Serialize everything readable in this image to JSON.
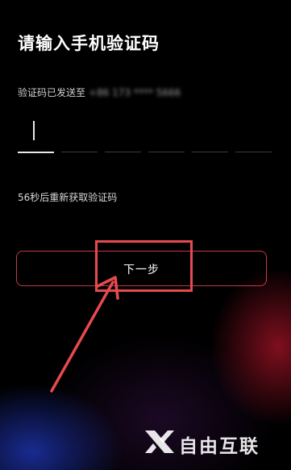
{
  "page": {
    "title": "请输入手机验证码",
    "sent_label": "验证码已发送至",
    "phone_masked": "+86 173 **** 5666",
    "code_digits": [
      "",
      "",
      "",
      "",
      "",
      ""
    ],
    "resend_text": "56秒后重新获取验证码",
    "next_button_label": "下一步"
  },
  "annotation": {
    "color": "#e64a4f"
  },
  "watermark": {
    "text": "自由互联",
    "logo_icon": "x-logo-icon"
  },
  "colors": {
    "background": "#000000",
    "button_border": "#c23a4a"
  }
}
